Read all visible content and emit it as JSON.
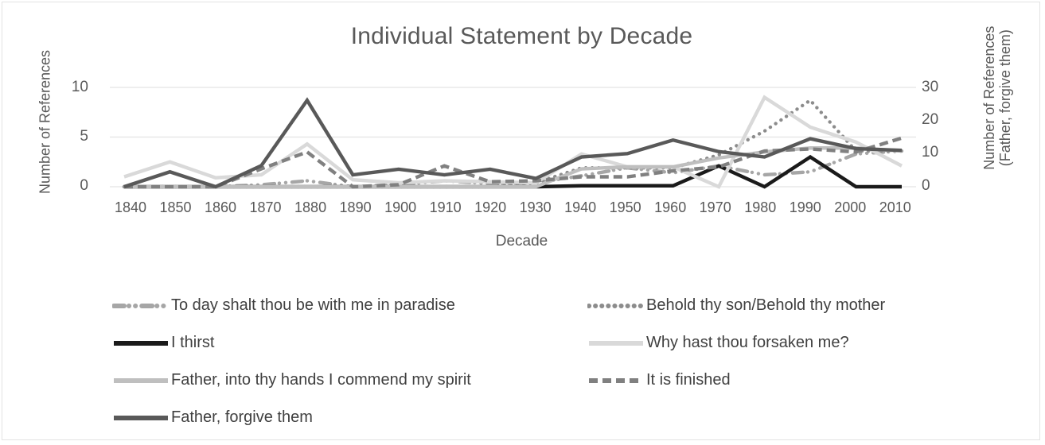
{
  "chart_data": {
    "type": "line",
    "title": "Individual Statement by Decade",
    "xlabel": "Decade",
    "ylabel": "Number of References",
    "ylabel_secondary": "Number of References (Father, forgive them)",
    "ylabel_secondary_line1": "Number of References",
    "ylabel_secondary_line2": "(Father, forgive them)",
    "ylim": [
      0,
      10
    ],
    "ylim_secondary": [
      0,
      30
    ],
    "yticks": [
      "0",
      "5",
      "10"
    ],
    "yticks_secondary": [
      "0",
      "10",
      "20",
      "30"
    ],
    "grid": true,
    "legend_position": "bottom",
    "categories": [
      "1840",
      "1850",
      "1860",
      "1870",
      "1880",
      "1890",
      "1900",
      "1910",
      "1920",
      "1930",
      "1940",
      "1950",
      "1960",
      "1970",
      "1980",
      "1990",
      "2000",
      "2010"
    ],
    "series": [
      {
        "name": "To day shalt thou be with me in paradise",
        "axis": "left",
        "color": "#a6a6a6",
        "dash": "dash-dot-dot",
        "values": [
          0,
          0,
          0,
          0.2,
          0.6,
          0,
          0.2,
          0.6,
          0.3,
          0.4,
          1.1,
          1.9,
          1.4,
          2.1,
          1.2,
          1.5,
          3.3,
          3.6
        ]
      },
      {
        "name": "Behold thy son/Behold thy mother",
        "axis": "left",
        "color": "#8c8c8c",
        "dash": "dotted",
        "values": [
          0,
          0,
          0,
          0,
          0,
          0,
          0,
          0,
          0,
          0.4,
          1.9,
          1.9,
          1.9,
          3.2,
          5.6,
          8.7,
          3.6,
          3.6
        ]
      },
      {
        "name": "I thirst",
        "axis": "left",
        "color": "#1a1a1a",
        "dash": "solid",
        "values": [
          0,
          0,
          0,
          0,
          0,
          0,
          0,
          0,
          0,
          0,
          0.1,
          0.1,
          0.1,
          2.1,
          0,
          3.0,
          0,
          0
        ]
      },
      {
        "name": "Why hast thou forsaken me?",
        "axis": "left",
        "color": "#d9d9d9",
        "dash": "solid",
        "values": [
          1.0,
          2.5,
          0.9,
          1.2,
          4.3,
          0.7,
          0.4,
          0.6,
          0.5,
          0.4,
          3.3,
          2.0,
          2.0,
          0,
          9.0,
          6.0,
          4.5,
          2.1
        ]
      },
      {
        "name": "Father, into thy hands I commend my spirit",
        "axis": "left",
        "color": "#bfbfbf",
        "dash": "solid",
        "values": [
          0,
          0,
          0,
          0,
          0,
          0,
          0,
          0,
          0,
          0,
          1.8,
          2.0,
          2.0,
          2.9,
          3.5,
          3.9,
          3.9,
          3.6
        ]
      },
      {
        "name": "It is finished",
        "axis": "left",
        "color": "#808080",
        "dash": "dashed",
        "values": [
          0,
          0,
          0,
          1.8,
          3.5,
          0,
          0.2,
          2.1,
          0.5,
          0.6,
          1.0,
          1.0,
          1.6,
          2.0,
          3.6,
          3.8,
          3.5,
          4.9
        ]
      },
      {
        "name": "Father, forgive them",
        "axis": "right",
        "color": "#595959",
        "dash": "solid",
        "values": [
          0,
          4.5,
          0,
          6.4,
          26.1,
          3.6,
          5.3,
          3.6,
          5.3,
          2.5,
          9.0,
          10.0,
          14.1,
          10.6,
          9.0,
          14.5,
          11.5,
          11.0
        ]
      }
    ]
  },
  "legend": {
    "rows": [
      [
        {
          "label": "To day shalt thou be with me in paradise",
          "color": "#a6a6a6",
          "dash": "dash-dot-dot"
        },
        {
          "label": "Behold thy son/Behold thy mother",
          "color": "#8c8c8c",
          "dash": "dotted"
        }
      ],
      [
        {
          "label": "I thirst",
          "color": "#1a1a1a",
          "dash": "solid"
        },
        {
          "label": "Why hast thou forsaken me?",
          "color": "#d9d9d9",
          "dash": "solid"
        }
      ],
      [
        {
          "label": "Father, into thy hands I commend my spirit",
          "color": "#bfbfbf",
          "dash": "solid"
        },
        {
          "label": "It is finished",
          "color": "#808080",
          "dash": "dashed"
        }
      ],
      [
        {
          "label": "Father, forgive them",
          "color": "#595959",
          "dash": "solid"
        }
      ]
    ]
  },
  "colors": {
    "text": "#595959",
    "gridline": "#e8e8e8",
    "border": "#e3e3e3",
    "background": "#ffffff"
  }
}
